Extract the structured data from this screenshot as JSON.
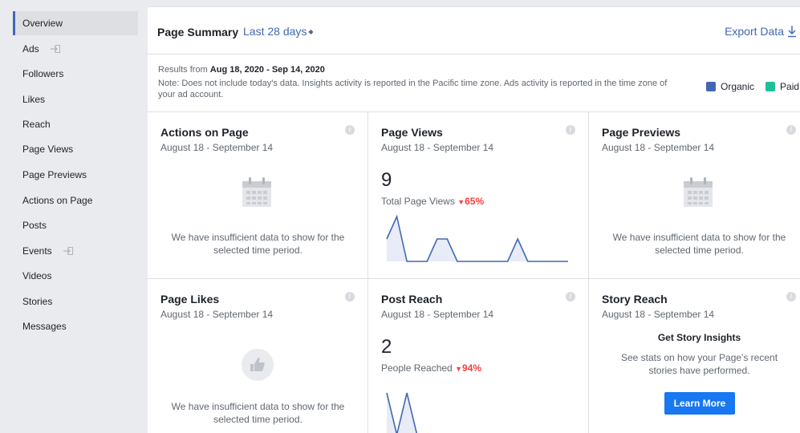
{
  "sidebar": {
    "items": [
      {
        "label": "Overview",
        "active": true
      },
      {
        "label": "Ads",
        "icon": "export-arrow-icon"
      },
      {
        "label": "Followers"
      },
      {
        "label": "Likes"
      },
      {
        "label": "Reach"
      },
      {
        "label": "Page Views"
      },
      {
        "label": "Page Previews"
      },
      {
        "label": "Actions on Page"
      },
      {
        "label": "Posts"
      },
      {
        "label": "Events",
        "icon": "export-arrow-icon"
      },
      {
        "label": "Videos"
      },
      {
        "label": "Stories"
      },
      {
        "label": "Messages"
      }
    ]
  },
  "header": {
    "title": "Page Summary",
    "range": "Last 28 days",
    "export_label": "Export Data"
  },
  "results": {
    "prefix": "Results from ",
    "date_range": "Aug 18, 2020 - Sep 14, 2020",
    "note": "Note: Does not include today's data. Insights activity is reported in the Pacific time zone. Ads activity is reported in the time zone of your ad account.",
    "legend": [
      {
        "label": "Organic",
        "color": "#4267b2"
      },
      {
        "label": "Paid",
        "color": "#1fbf9c"
      }
    ]
  },
  "cards": {
    "actions": {
      "title": "Actions on Page",
      "subtitle": "August 18 - September 14",
      "empty": "We have insufficient data to show for the selected time period."
    },
    "views": {
      "title": "Page Views",
      "subtitle": "August 18 - September 14",
      "value": "9",
      "label": "Total Page Views",
      "change": "65%",
      "spark": [
        3,
        6,
        0,
        0,
        0,
        3,
        3,
        0,
        0,
        0,
        0,
        0,
        0,
        3,
        0,
        0,
        0,
        0,
        0
      ]
    },
    "previews": {
      "title": "Page Previews",
      "subtitle": "August 18 - September 14",
      "empty": "We have insufficient data to show for the selected time period."
    },
    "likes": {
      "title": "Page Likes",
      "subtitle": "August 18 - September 14",
      "empty": "We have insufficient data to show for the selected time period."
    },
    "reach": {
      "title": "Post Reach",
      "subtitle": "August 18 - September 14",
      "value": "2",
      "label": "People Reached",
      "change": "94%",
      "spark": [
        6,
        0,
        6,
        0,
        0,
        0,
        0,
        0,
        0,
        0,
        0,
        0,
        0,
        0,
        0,
        0,
        0,
        0,
        0
      ]
    },
    "story": {
      "title": "Story Reach",
      "subtitle": "August 18 - September 14",
      "heading": "Get Story Insights",
      "text": "See stats on how your Page's recent stories have performed.",
      "button": "Learn More"
    }
  },
  "colors": {
    "accent": "#4267b2",
    "button": "#1877f2",
    "decline": "#fa3e3e"
  }
}
